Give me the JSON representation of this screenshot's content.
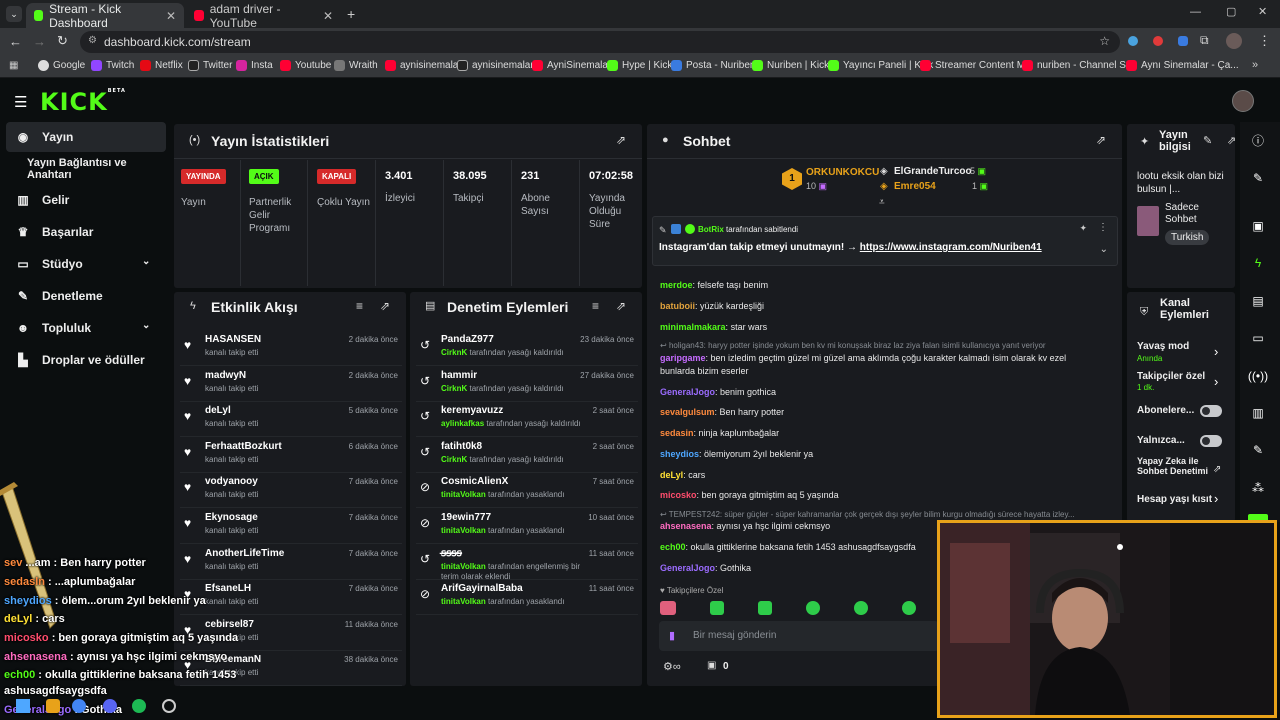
{
  "browser": {
    "tabs": [
      {
        "title": "Stream - Kick Dashboard",
        "active": true
      },
      {
        "title": "adam driver - YouTube",
        "active": false
      }
    ],
    "url": "dashboard.kick.com/stream",
    "bookmarks": [
      "Google",
      "Twitch",
      "Netflix",
      "Twitter",
      "Insta",
      "Youtube",
      "Wraith",
      "aynisinemalar",
      "aynisinemalar",
      "AyniSinemalar",
      "Hype | Kick",
      "Posta - Nuriben",
      "Nuriben | Kick",
      "Yayıncı Paneli | Kick",
      "Streamer Content M...",
      "nuriben - Channel S...",
      "Aynı Sinemalar - Ça..."
    ]
  },
  "brand": {
    "logo": "KICK",
    "tag": "BETA",
    "accent": "#53fc18"
  },
  "sidebar": {
    "items": [
      {
        "label": "Yayın",
        "icon": "broadcast-icon"
      },
      {
        "label": "Yayın Bağlantısı ve Anahtarı",
        "icon": ""
      },
      {
        "label": "Gelir",
        "icon": "chart-icon"
      },
      {
        "label": "Başarılar",
        "icon": "trophy-icon"
      },
      {
        "label": "Stüdyo",
        "icon": "studio-icon"
      },
      {
        "label": "Denetleme",
        "icon": "wrench-icon"
      },
      {
        "label": "Topluluk",
        "icon": "community-icon"
      },
      {
        "label": "Droplar ve ödüller",
        "icon": "drops-icon"
      }
    ]
  },
  "stats": {
    "title": "Yayın İstatistikleri",
    "cells": [
      {
        "badge": "YAYINDA",
        "label": "Yayın"
      },
      {
        "badge": "AÇIK",
        "label": "Partnerlik Gelir Programı"
      },
      {
        "badge": "KAPALI",
        "label": "Çoklu Yayın"
      },
      {
        "value": "3.401",
        "label": "İzleyici"
      },
      {
        "value": "38.095",
        "label": "Takipçi"
      },
      {
        "value": "231",
        "label": "Abone Sayısı"
      },
      {
        "value": "07:02:58",
        "label": "Yayında Olduğu Süre"
      }
    ]
  },
  "activity": {
    "title": "Etkinlik Akışı",
    "rows": [
      {
        "name": "HASANSEN",
        "sub": "kanalı takip etti",
        "time": "2 dakika önce"
      },
      {
        "name": "madwyN",
        "sub": "kanalı takip etti",
        "time": "2 dakika önce"
      },
      {
        "name": "deLyl",
        "sub": "kanalı takip etti",
        "time": "5 dakika önce"
      },
      {
        "name": "FerhaattBozkurt",
        "sub": "kanalı takip etti",
        "time": "6 dakika önce"
      },
      {
        "name": "vodyanooy",
        "sub": "kanalı takip etti",
        "time": "7 dakika önce"
      },
      {
        "name": "Ekynosage",
        "sub": "kanalı takip etti",
        "time": "7 dakika önce"
      },
      {
        "name": "AnotherLifeTime",
        "sub": "kanalı takip etti",
        "time": "7 dakika önce"
      },
      {
        "name": "EfsaneLH",
        "sub": "kanalı takip etti",
        "time": "7 dakika önce"
      },
      {
        "name": "cebirsel87",
        "sub": "kanalı takip etti",
        "time": "11 dakika önce"
      },
      {
        "name": "BFreemanN",
        "sub": "kanalı takip etti",
        "time": "38 dakika önce"
      }
    ]
  },
  "moderation": {
    "title": "Denetim Eylemleri",
    "rows": [
      {
        "name": "PandaZ977",
        "by": "CirknK",
        "sub": "tarafından yasağı kaldırıldı",
        "time": "23 dakika önce",
        "icon": "undo-icon"
      },
      {
        "name": "hammir",
        "by": "CirknK",
        "sub": "tarafından yasağı kaldırıldı",
        "time": "27 dakika önce",
        "icon": "undo-icon"
      },
      {
        "name": "keremyavuzz",
        "by": "aylinkafkas",
        "sub": "tarafından yasağı kaldırıldı",
        "time": "2 saat önce",
        "icon": "undo-icon"
      },
      {
        "name": "fatiht0k8",
        "by": "CirknK",
        "sub": "tarafından yasağı kaldırıldı",
        "time": "2 saat önce",
        "icon": "undo-icon"
      },
      {
        "name": "CosmicAlienX",
        "by": "tinitaVolkan",
        "sub": "tarafından yasaklandı",
        "time": "7 saat önce",
        "icon": "ban-icon"
      },
      {
        "name": "19ewin777",
        "by": "tinitaVolkan",
        "sub": "tarafından yasaklandı",
        "time": "10 saat önce",
        "icon": "ban-icon"
      },
      {
        "name": "ꞩ̶ꞩ̶ꞩ̶ꞩ̶",
        "by": "tinitaVolkan",
        "sub": "tarafından engellenmiş bir terim olarak eklendi",
        "time": "11 saat önce",
        "icon": "undo-icon"
      },
      {
        "name": "ArifGayirnalBaba",
        "by": "tinitaVolkan",
        "sub": "tarafından yasaklandı",
        "time": "11 saat önce",
        "icon": "ban-icon"
      }
    ]
  },
  "chat": {
    "title": "Sohbet",
    "leaders": [
      {
        "rank": "1",
        "name": "ORKUNKOKCU",
        "count": "10"
      },
      {
        "name": "ElGrandeTurcoo",
        "count": "5"
      },
      {
        "name": "Emre054",
        "count": "1"
      }
    ],
    "pinned": {
      "by": "BotRix",
      "label": "tarafından sabitlendi",
      "text": "Instagram'dan takip etmeyi unutmayın! →",
      "link": "https://www.instagram.com/Nuriben41"
    },
    "messages": [
      {
        "user": "merdoe",
        "color": "#53fc18",
        "text": "felsefe taşı benim"
      },
      {
        "user": "batuboii",
        "color": "#e2a33c",
        "text": "yüzük kardeşliği"
      },
      {
        "user": "minimalmakara",
        "color": "#53fc18",
        "text": "star wars"
      },
      {
        "reply": "holigan43: haryy potter işinde yokum ben kv mi konuşsak biraz laz ziya falan isimli kullanıcıya yanıt veriyor"
      },
      {
        "user": "garipgame",
        "color": "#c66cff",
        "text": "ben izledim geçtim güzel mi güzel ama aklımda çoğu karakter kalmadı isim olarak kv ezel",
        "text2": "bunlarda bizim eserler"
      },
      {
        "user": "GeneralJogo",
        "color": "#9b6cff",
        "text": "benim gothica"
      },
      {
        "user": "sevalgulsum",
        "color": "#ff8a3d",
        "text": "Ben harry potter"
      },
      {
        "user": "sedasin",
        "color": "#ff8a3d",
        "text": "ninja kaplumbağalar"
      },
      {
        "user": "sheydios",
        "color": "#4ea7ff",
        "text": "ölemiyorum 2yıl beklenir ya"
      },
      {
        "user": "deLyl",
        "color": "#ffe135",
        "text": "cars"
      },
      {
        "user": "micosko",
        "color": "#ff4d6d",
        "text": "ben goraya gitmiştim aq 5 yaşında"
      },
      {
        "reply": "TEMPEST242: süper güçler - süper kahramanlar çok gerçek dışı şeyler bilim kurgu olmadığı sürece hayatta izley..."
      },
      {
        "user": "ahsenasena",
        "color": "#ff6cc1",
        "text": "aynısı ya hşc ilgimi cekmsyo"
      },
      {
        "user": "ech00",
        "color": "#53fc18",
        "text": "okulla gittiklerine baksana fetih 1453 ashusagdfsaygsdfa"
      },
      {
        "user": "GeneralJogo",
        "color": "#9b6cff",
        "text": "Gothika"
      }
    ],
    "followers_only": "Takipçilere Özel",
    "input_placeholder": "Bir mesaj gönderin",
    "counter": "0"
  },
  "stream_info": {
    "title": "Yayın bilgisi",
    "stream_title": "lootu eksik olan bizi bulsun |...",
    "category": "Sadece Sohbet",
    "tag": "Turkish"
  },
  "channel_actions": {
    "title": "Kanal Eylemleri",
    "items": [
      {
        "label": "Yavaş mod",
        "sub": "Anında",
        "control": "chevron"
      },
      {
        "label": "Takipçiler özel",
        "sub": "1 dk.",
        "control": "chevron"
      },
      {
        "label": "Abonelere...",
        "control": "toggle"
      },
      {
        "label": "Yalnızca...",
        "control": "toggle"
      },
      {
        "label": "Yapay Zeka ile Sohbet Denetimi",
        "control": "external"
      },
      {
        "label": "Hesap yaşı kısıt",
        "control": "chevron"
      }
    ]
  },
  "overlay_chat": [
    {
      "user": "sev",
      "color": "#ff8a3d",
      "text": "...am : Ben harry potter"
    },
    {
      "user": "sedasln",
      "color": "#ff8a3d",
      "text": ": ...aplumbağalar"
    },
    {
      "user": "sheydios",
      "color": "#4ea7ff",
      "text": ": ölem...orum 2yıl beklenir ya"
    },
    {
      "user": "deLyl",
      "color": "#ffe135",
      "text": ": cars"
    },
    {
      "user": "micosko",
      "color": "#ff4d6d",
      "text": ": ben goraya gitmiştim aq 5 yaşında"
    },
    {
      "user": "ahsenasena",
      "color": "#ff6cc1",
      "text": ": aynısı ya hşc ilgimi cekmsyo"
    },
    {
      "user": "ech00",
      "color": "#53fc18",
      "text": ": okulla gittiklerine baksana fetih 1453"
    },
    {
      "user": "",
      "color": "#ffffff",
      "text": "ashusagdfsaygsdfa"
    },
    {
      "user": "GeneralJogo",
      "color": "#9b6cff",
      "text": ": Gothika"
    }
  ]
}
